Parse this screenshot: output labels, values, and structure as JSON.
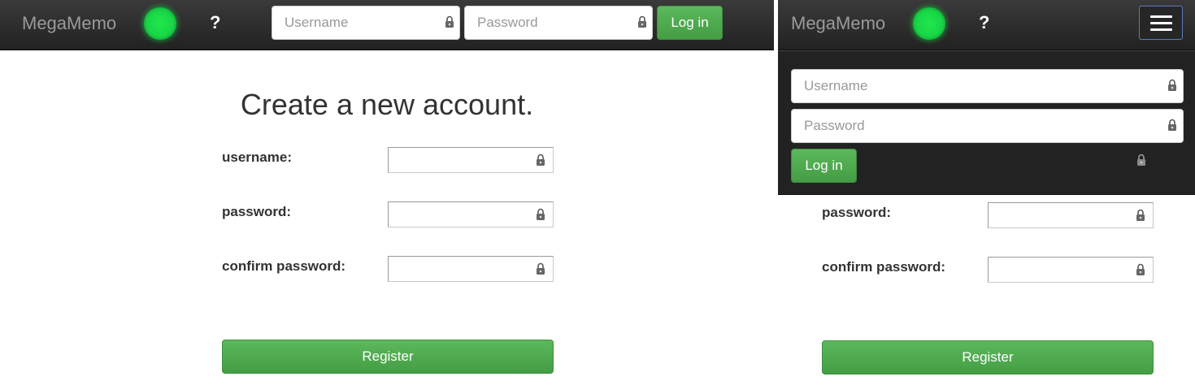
{
  "navbar": {
    "brand": "MegaMemo",
    "help_label": "?",
    "username_placeholder": "Username",
    "password_placeholder": "Password",
    "login_label": "Log in"
  },
  "form": {
    "title": "Create a new account.",
    "username_label": "username:",
    "password_label": "password:",
    "confirm_label": "confirm password:",
    "register_label": "Register"
  },
  "colors": {
    "navbar_bg": "#222222",
    "status": "#19d646",
    "button": "#449d44"
  },
  "icons": [
    "lock-icon",
    "menu-icon",
    "status-indicator"
  ]
}
